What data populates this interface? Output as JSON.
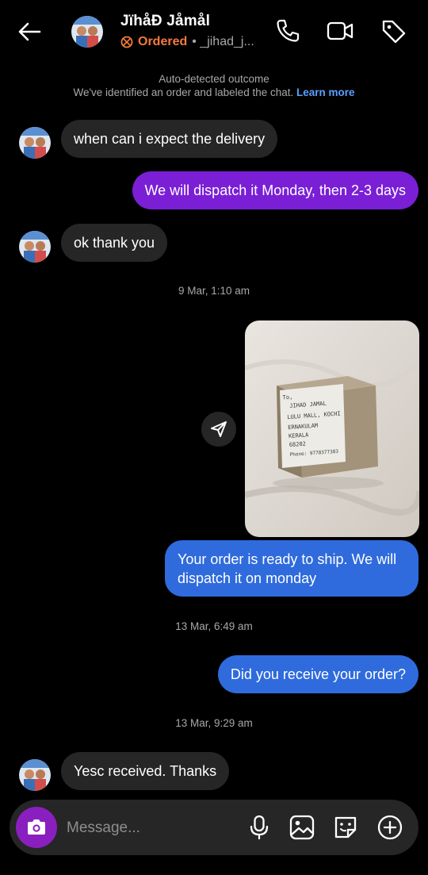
{
  "header": {
    "name": "JïhåĐ Jåmål",
    "status": "Ordered",
    "handle": "• _jihad_j..."
  },
  "notice": {
    "line1": "Auto-detected outcome",
    "line2": "We've identified an order and labeled the chat.",
    "link": "Learn more"
  },
  "messages": [
    {
      "side": "in",
      "text": "when can i expect the delivery"
    },
    {
      "side": "out",
      "text": "We will dispatch it Monday, then 2-3 days"
    },
    {
      "side": "in",
      "text": "ok thank you"
    },
    {
      "timestamp": "9 Mar, 1:10 am"
    },
    {
      "side": "out",
      "type": "photo",
      "package_text": [
        "To,",
        "JIHAD JAMAL",
        "LULU MALL, KOCHI",
        "ERNAKULAM",
        "KERALA",
        "68202",
        "Phone: 9778377383"
      ]
    },
    {
      "side": "out",
      "text_line1": "Your order is ready to ship. We will",
      "text_line2": "dispatch it on monday"
    },
    {
      "timestamp": "13 Mar, 6:49 am"
    },
    {
      "side": "out",
      "text": "Did you receive your order?"
    },
    {
      "timestamp": "13 Mar, 9:29 am"
    },
    {
      "side": "in",
      "text": "Yesc received. Thanks"
    }
  ],
  "composer": {
    "placeholder": "Message..."
  },
  "colors": {
    "background": "#000000",
    "incoming_bubble": "#262626",
    "outgoing_purple": "#7a1fd6",
    "outgoing_blue": "#2f6bdc",
    "ordered_accent": "#f47b3c",
    "link": "#5aa0ff",
    "camera_button": "#8a1fbf"
  },
  "icons": [
    "back-arrow-icon",
    "phone-icon",
    "video-icon",
    "tag-icon",
    "share-icon",
    "camera-icon",
    "microphone-icon",
    "gallery-icon",
    "sticker-icon",
    "plus-icon"
  ]
}
